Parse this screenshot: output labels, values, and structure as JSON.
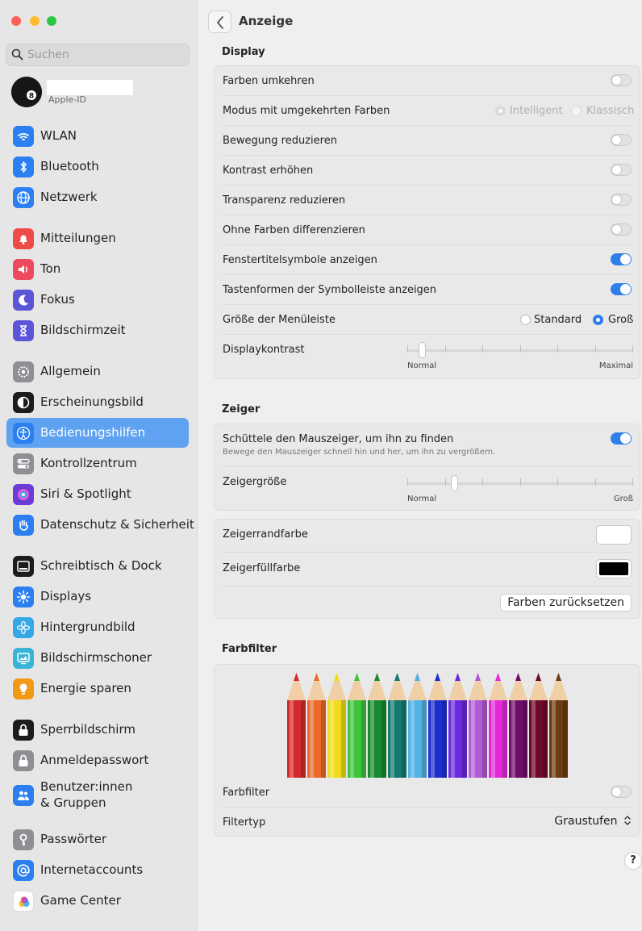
{
  "window": {
    "colors": {
      "close": "#fe5f57",
      "minimize": "#febc2e",
      "zoom": "#28c840",
      "accent": "#2f7fe8"
    }
  },
  "search": {
    "placeholder": "Suchen"
  },
  "profile": {
    "subtitle": "Apple-ID"
  },
  "sidebar": {
    "items": [
      {
        "label": "WLAN",
        "icon": "wifi-icon",
        "color": "#2b7ff0"
      },
      {
        "label": "Bluetooth",
        "icon": "bluetooth-icon",
        "color": "#2b7ff0"
      },
      {
        "label": "Netzwerk",
        "icon": "globe-icon",
        "color": "#2b7ff0"
      },
      {
        "label": "Mitteilungen",
        "icon": "bell-icon",
        "color": "#ee4a48"
      },
      {
        "label": "Ton",
        "icon": "speaker-icon",
        "color": "#ee4a5e"
      },
      {
        "label": "Fokus",
        "icon": "moon-icon",
        "color": "#5b55d8"
      },
      {
        "label": "Bildschirmzeit",
        "icon": "hourglass-icon",
        "color": "#5b55d8"
      },
      {
        "label": "Allgemein",
        "icon": "gear-icon",
        "color": "#8e8e93"
      },
      {
        "label": "Erscheinungsbild",
        "icon": "appearance-icon",
        "color": "#1c1c1e"
      },
      {
        "label": "Bedienungshilfen",
        "icon": "accessibility-icon",
        "color": "#2b7ff0"
      },
      {
        "label": "Kontrollzentrum",
        "icon": "switches-icon",
        "color": "#8e8e93"
      },
      {
        "label": "Siri & Spotlight",
        "icon": "siri-icon",
        "color": "#6a3bd6"
      },
      {
        "label": "Datenschutz & Sicherheit",
        "icon": "hand-icon",
        "color": "#2b7ff0"
      },
      {
        "label": "Schreibtisch & Dock",
        "icon": "dock-icon",
        "color": "#1c1c1e"
      },
      {
        "label": "Displays",
        "icon": "sun-icon",
        "color": "#2b7ff0"
      },
      {
        "label": "Hintergrundbild",
        "icon": "flower-icon",
        "color": "#35a8e8"
      },
      {
        "label": "Bildschirmschoner",
        "icon": "screensaver-icon",
        "color": "#37b4d6"
      },
      {
        "label": "Energie sparen",
        "icon": "bulb-icon",
        "color": "#f29a16"
      },
      {
        "label": "Sperrbildschirm",
        "icon": "lock-screen-icon",
        "color": "#1c1c1e"
      },
      {
        "label": "Anmeldepasswort",
        "icon": "lock-icon",
        "color": "#8e8e93"
      },
      {
        "label": "Benutzer:innen\n& Gruppen",
        "icon": "users-icon",
        "color": "#2b7ff0"
      },
      {
        "label": "Passwörter",
        "icon": "key-icon",
        "color": "#8e8e93"
      },
      {
        "label": "Internetaccounts",
        "icon": "at-icon",
        "color": "#2b7ff0"
      },
      {
        "label": "Game Center",
        "icon": "game-center-icon",
        "color": "#ffffff"
      }
    ]
  },
  "header": {
    "title": "Anzeige"
  },
  "display": {
    "title": "Display",
    "rows": [
      {
        "label": "Farben umkehren",
        "on": false
      },
      {
        "label": "Modus mit umgekehrten Farben",
        "options": [
          "Intelligent",
          "Klassisch"
        ],
        "selected": "Intelligent",
        "disabled": true
      },
      {
        "label": "Bewegung reduzieren",
        "on": false
      },
      {
        "label": "Kontrast erhöhen",
        "on": false
      },
      {
        "label": "Transparenz reduzieren",
        "on": false
      },
      {
        "label": "Ohne Farben differenzieren",
        "on": false
      },
      {
        "label": "Fenstertitelsymbole anzeigen",
        "on": true
      },
      {
        "label": "Tastenformen der Symbolleiste anzeigen",
        "on": true
      },
      {
        "label": "Größe der Menüleiste",
        "options": [
          "Standard",
          "Groß"
        ],
        "selected": "Groß"
      },
      {
        "label": "Displaykontrast",
        "slider": {
          "min_label": "Normal",
          "max_label": "Maximal",
          "value": 0.05
        }
      }
    ]
  },
  "pointer": {
    "title": "Zeiger",
    "shake": {
      "label": "Schüttele den Mauszeiger, um ihn zu finden",
      "sub": "Bewege den Mauszeiger schnell hin und her, um ihn zu vergrößern.",
      "on": true
    },
    "size": {
      "label": "Zeigergröße",
      "min_label": "Normal",
      "max_label": "Groß",
      "value": 0.2
    },
    "outline": {
      "label": "Zeigerrandfarbe",
      "color": "#ffffff"
    },
    "fill": {
      "label": "Zeigerfüllfarbe",
      "color": "#000000"
    },
    "reset_label": "Farben zurücksetzen"
  },
  "filters": {
    "title": "Farbfilter",
    "pencil_colors": [
      "#d42a2a",
      "#ea6a2c",
      "#f0dc1a",
      "#3cc43a",
      "#178a2f",
      "#137a70",
      "#52b2e4",
      "#1e2fd0",
      "#6a2ae0",
      "#b15ad6",
      "#e22ad8",
      "#6e0e6a",
      "#6e0a2c",
      "#6b3c10"
    ],
    "toggle": {
      "label": "Farbfilter",
      "on": false
    },
    "type": {
      "label": "Filtertyp",
      "value": "Graustufen"
    }
  },
  "help": "?"
}
